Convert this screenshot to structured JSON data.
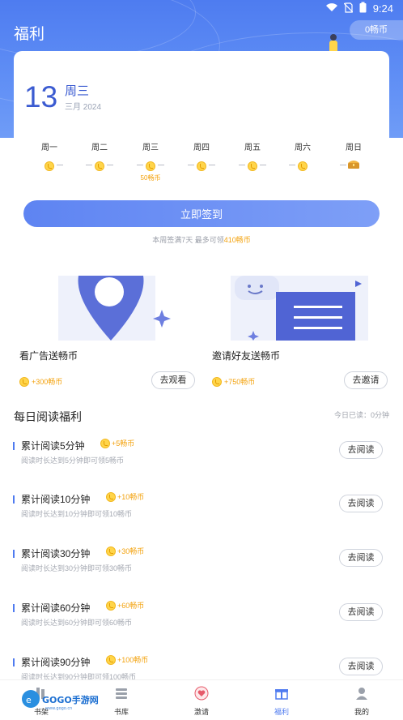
{
  "status": {
    "time": "9:24"
  },
  "header": {
    "title": "福利",
    "coin_balance": "0畅币"
  },
  "date": {
    "day": "13",
    "weekday": "周三",
    "month_year": "三月 2024"
  },
  "week": [
    {
      "label": "周一",
      "sub": ""
    },
    {
      "label": "周二",
      "sub": ""
    },
    {
      "label": "周三",
      "sub": "50畅币"
    },
    {
      "label": "周四",
      "sub": ""
    },
    {
      "label": "周五",
      "sub": ""
    },
    {
      "label": "周六",
      "sub": ""
    },
    {
      "label": "周日",
      "sub": ""
    }
  ],
  "signin": {
    "button": "立即签到",
    "tip_prefix": "本周签满7天 最多可领",
    "tip_amount": "410畅币"
  },
  "promos": [
    {
      "title": "看广告送畅币",
      "reward": "+300畅币",
      "button": "去观看"
    },
    {
      "title": "邀请好友送畅币",
      "reward": "+750畅币",
      "button": "去邀请"
    }
  ],
  "reading": {
    "title": "每日阅读福利",
    "today": "今日已读：0分钟",
    "tasks": [
      {
        "name": "累计阅读5分钟",
        "reward": "+5畅币",
        "desc": "阅读时长达到5分钟即可领5畅币",
        "button": "去阅读"
      },
      {
        "name": "累计阅读10分钟",
        "reward": "+10畅币",
        "desc": "阅读时长达到10分钟即可领10畅币",
        "button": "去阅读"
      },
      {
        "name": "累计阅读30分钟",
        "reward": "+30畅币",
        "desc": "阅读时长达到30分钟即可领30畅币",
        "button": "去阅读"
      },
      {
        "name": "累计阅读60分钟",
        "reward": "+60畅币",
        "desc": "阅读时长达到60分钟即可领60畅币",
        "button": "去阅读"
      },
      {
        "name": "累计阅读90分钟",
        "reward": "+100畅币",
        "desc": "阅读时长达到90分钟即可领100畅币",
        "button": "去阅读"
      }
    ]
  },
  "tabs": [
    {
      "label": "书架",
      "icon": "bookshelf-icon"
    },
    {
      "label": "书库",
      "icon": "library-icon"
    },
    {
      "label": "激请",
      "icon": "heart-badge-icon"
    },
    {
      "label": "福利",
      "icon": "gift-icon"
    },
    {
      "label": "我的",
      "icon": "person-icon"
    }
  ],
  "watermark": "GOGO手游网",
  "colors": {
    "primary": "#4f7bf0",
    "coin": "#f3a20d"
  }
}
